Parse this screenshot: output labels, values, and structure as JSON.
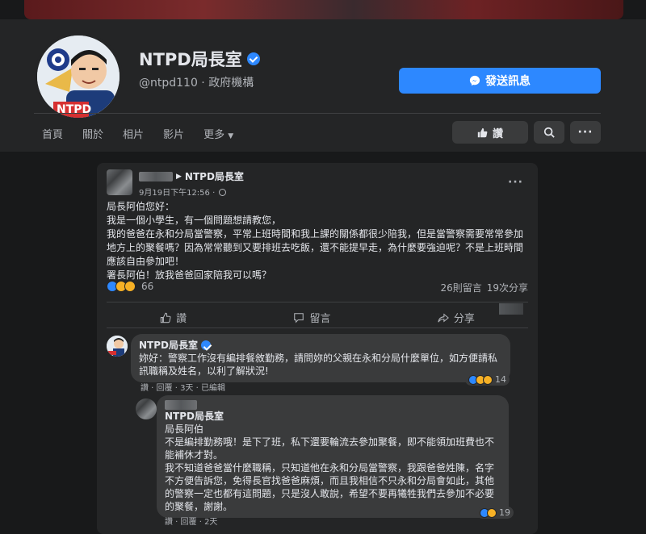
{
  "page": {
    "name": "NTPD局長室",
    "handle_category": "@ntpd110 · 政府機構",
    "message_button": "發送訊息",
    "nav": [
      "首頁",
      "關於",
      "相片",
      "影片",
      "更多"
    ],
    "like_button": "讚",
    "avatar_label": "NTPD"
  },
  "post": {
    "author_suffix": "NTPD局長室",
    "time": "9月19日下午12:56 ·",
    "body": [
      "局長阿伯您好：",
      "我是一個小學生，有一個問題想請教您，",
      "我的爸爸在永和分局當警察，平常上班時間和我上課的關係都很少陪我，但是當警察需要常常參加地方上的聚餐嗎？因為常常聽到又要排班去吃飯，還不能提早走，為什麼要強迫呢？不是上班時間應該自由參加吧！",
      "署長阿伯！放我爸爸回家陪我可以嗎？"
    ],
    "reaction_count": "66",
    "comments": "26則留言",
    "shares": "19次分享",
    "actions": [
      "讚",
      "留言",
      "分享"
    ]
  },
  "comments": [
    {
      "name": "NTPD局長室",
      "text": "妳好：警察工作沒有編排餐敘勤務，請問妳的父親在永和分局什麼單位，如方便請私訊職稱及姓名，以利了解狀況!",
      "meta": "讚 · 回覆 · 3天 · 已編輯",
      "reactions": "14"
    },
    {
      "name": "NTPD局長室",
      "lines": [
        "局長阿伯",
        "不是編排勤務哦！是下了班，私下還要輪流去參加聚餐，即不能領加班費也不能補休才對。",
        "我不知道爸爸當什麼職稱，只知道他在永和分局當警察，我跟爸爸姓陳，名字不方便告訴您，免得長官找爸爸麻煩，而且我相信不只永和分局會如此，其他的警察一定也都有這問題，只是沒人敢說，希望不要再犧牲我們去參加不必要的聚餐，謝謝。"
      ],
      "meta": "讚 · 回覆 · 2天",
      "reactions": "19"
    }
  ],
  "colors": {
    "background": "#18191a",
    "surface": "#242526",
    "bubble": "#3a3b3c",
    "accent": "#2d88ff",
    "text": "#e4e6eb",
    "secondary_text": "#b0b3b8"
  }
}
